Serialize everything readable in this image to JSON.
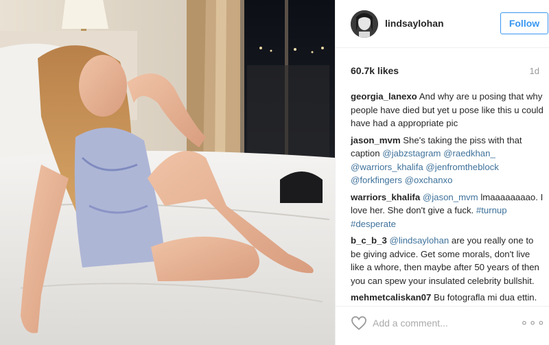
{
  "post": {
    "username": "lindsaylohan",
    "follow_label": "Follow",
    "likes": "60.7k likes",
    "age": "1d",
    "add_comment_placeholder": "Add a comment...",
    "more_label": "∘∘∘"
  },
  "comments": [
    {
      "user": "georgia_lanexo",
      "text": "And why are u posing that why people have died but yet u pose like this u could have had a appropriate pic"
    },
    {
      "user": "jason_mvm",
      "text": "She's taking the piss with that caption",
      "mentions": "@jabzstagram @raedkhan_ @warriors_khalifa @jenfromtheblock @forkfingers @oxchanxo"
    },
    {
      "user": "warriors_khalifa",
      "mention": "@jason_mvm",
      "text": "lmaaaaaaaao. I love her. She don't give a fuck.",
      "tags": "#turnup #desperate"
    },
    {
      "user": "b_c_b_3",
      "mention": "@lindsaylohan",
      "text": "are you really one to be giving advice. Get some morals, don't live like a whore, then maybe after 50 years of then you can spew your insulated celebrity bullshit."
    },
    {
      "user": "mehmetcaliskan07",
      "text": "Bu fotografla mi dua ettin."
    }
  ],
  "colors": {
    "link": "#3f729b",
    "follow": "#3897f0",
    "muted": "#999999"
  }
}
